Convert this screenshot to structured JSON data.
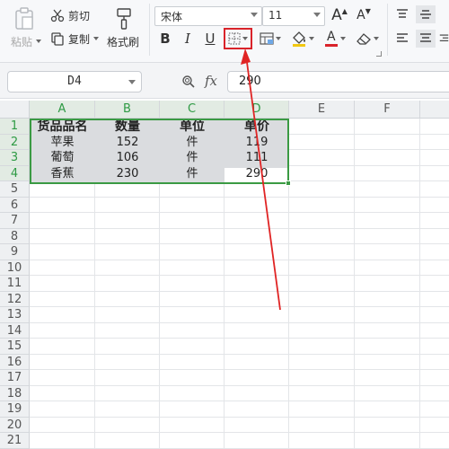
{
  "ribbon": {
    "paste_label": "粘贴",
    "cut_label": "剪切",
    "copy_label": "复制",
    "format_painter_label": "格式刷",
    "font_name": "宋体",
    "font_size": "11",
    "increase_font_glyph": "A",
    "decrease_font_glyph": "A",
    "bold_glyph": "B",
    "italic_glyph": "I",
    "underline_glyph": "U",
    "font_color_glyph": "A",
    "accent_color": "#d9232a",
    "highlight_box_color": "#d9232a"
  },
  "formula_bar": {
    "cell_ref": "D4",
    "fx_label": "fx",
    "value": "290"
  },
  "sheet": {
    "columns": [
      "A",
      "B",
      "C",
      "D",
      "E",
      "F"
    ],
    "rows": [
      "1",
      "2",
      "3",
      "4",
      "5",
      "6",
      "7",
      "8",
      "9",
      "10",
      "11",
      "12",
      "13",
      "14",
      "15",
      "16",
      "17",
      "18",
      "19",
      "20",
      "21"
    ],
    "header": [
      "货品品名",
      "数量",
      "单位",
      "单价"
    ],
    "data": [
      [
        "苹果",
        "152",
        "件",
        "119"
      ],
      [
        "葡萄",
        "106",
        "件",
        "111"
      ],
      [
        "香蕉",
        "230",
        "件",
        "290"
      ]
    ],
    "selection_color": "#3a9a43"
  }
}
